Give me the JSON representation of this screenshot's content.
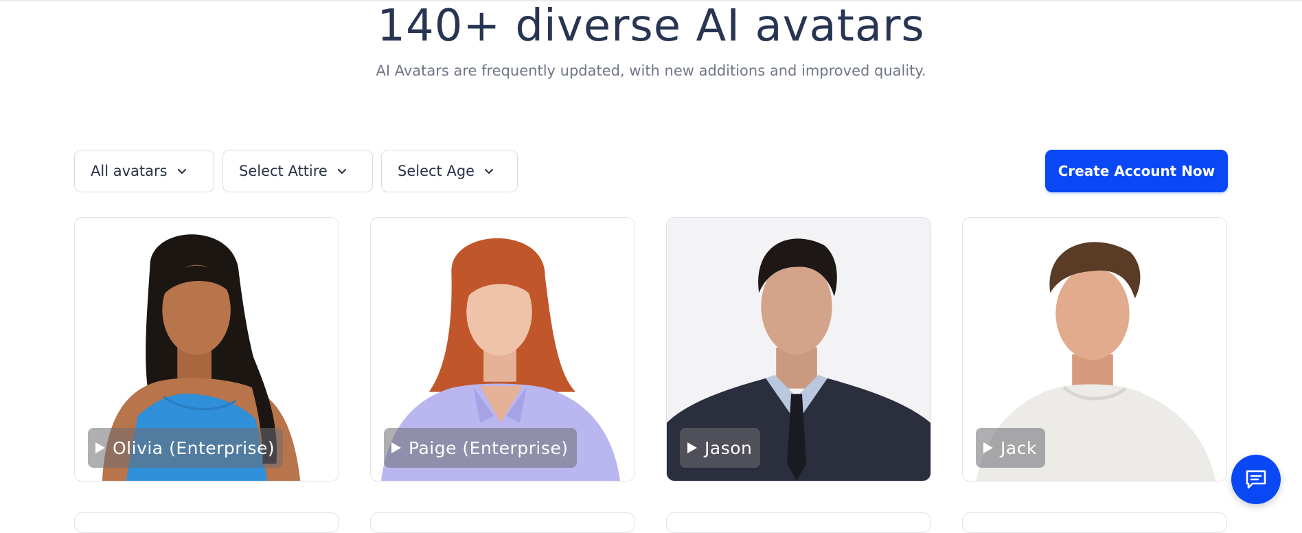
{
  "header": {
    "title": "140+ diverse AI avatars",
    "subtitle": "AI Avatars are frequently updated, with new additions and improved quality."
  },
  "filters": [
    {
      "label": "All avatars",
      "icon": "chevron-down-icon"
    },
    {
      "label": "Select Attire",
      "icon": "chevron-down-icon"
    },
    {
      "label": "Select Age",
      "icon": "chevron-down-icon"
    }
  ],
  "cta": {
    "label": "Create Account Now",
    "color": "#0a48f5"
  },
  "avatars": [
    {
      "name": "Olivia (Enterprise)",
      "attire_color": "#2f8fd8",
      "bg": "#ffffff"
    },
    {
      "name": "Paige (Enterprise)",
      "attire_color": "#b9b6f0",
      "bg": "#ffffff"
    },
    {
      "name": "Jason",
      "attire_color": "#2a2e3d",
      "bg": "#f3f3f5"
    },
    {
      "name": "Jack",
      "attire_color": "#ecebe8",
      "bg": "#ffffff"
    }
  ],
  "chat": {
    "icon": "chat-icon"
  }
}
